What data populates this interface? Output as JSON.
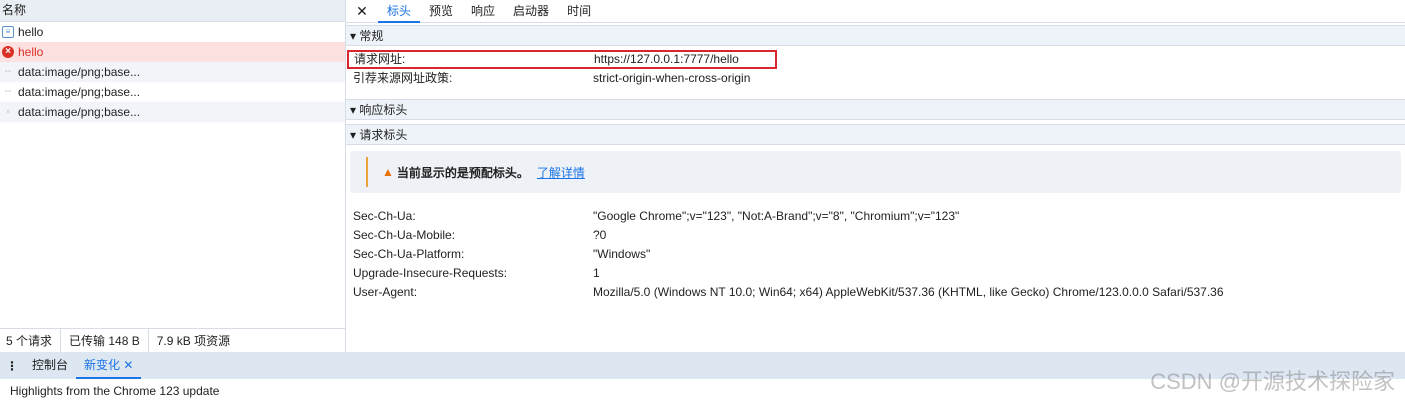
{
  "left": {
    "header": "名称",
    "requests": [
      {
        "name": "hello",
        "icon": "document-icon",
        "state": "normal"
      },
      {
        "name": "hello",
        "icon": "error-icon",
        "state": "error"
      },
      {
        "name": "data:image/png;base...",
        "icon": "dash-icon",
        "state": "normal"
      },
      {
        "name": "data:image/png;base...",
        "icon": "dash-icon",
        "state": "normal"
      },
      {
        "name": "data:image/png;base...",
        "icon": "image-icon",
        "state": "normal"
      }
    ],
    "status": [
      "5 个请求",
      "已传输 148 B",
      "7.9 kB 项资源"
    ]
  },
  "right": {
    "tabs": [
      "标头",
      "预览",
      "响应",
      "启动器",
      "时间"
    ],
    "general": {
      "title": "常规",
      "rows": [
        {
          "k": "请求网址:",
          "v": "https://127.0.0.1:7777/hello"
        },
        {
          "k": "引荐来源网址政策:",
          "v": "strict-origin-when-cross-origin"
        }
      ]
    },
    "response_headers": {
      "title": "响应标头"
    },
    "request_headers": {
      "title": "请求标头",
      "warning": "当前显示的是预配标头。",
      "learn_more": "了解详情",
      "rows": [
        {
          "k": "Sec-Ch-Ua:",
          "v": "\"Google Chrome\";v=\"123\", \"Not:A-Brand\";v=\"8\", \"Chromium\";v=\"123\""
        },
        {
          "k": "Sec-Ch-Ua-Mobile:",
          "v": "?0"
        },
        {
          "k": "Sec-Ch-Ua-Platform:",
          "v": "\"Windows\""
        },
        {
          "k": "Upgrade-Insecure-Requests:",
          "v": "1"
        },
        {
          "k": "User-Agent:",
          "v": "Mozilla/5.0 (Windows NT 10.0; Win64; x64) AppleWebKit/537.36 (KHTML, like Gecko) Chrome/123.0.0.0 Safari/537.36"
        }
      ]
    }
  },
  "drawer": {
    "tabs": [
      "控制台",
      "新变化"
    ],
    "content": "Highlights from the Chrome 123 update"
  },
  "watermark": "CSDN @开源技术探险家"
}
